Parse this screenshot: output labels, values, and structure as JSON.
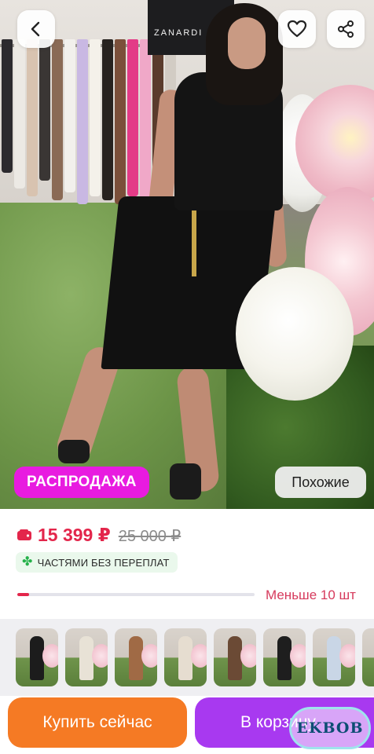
{
  "header": {
    "back_icon": "chevron-left-icon",
    "like_icon": "heart-icon",
    "share_icon": "share-icon"
  },
  "photo": {
    "store_sign": "ZANARDI",
    "sale_badge": "РАСПРОДАЖА",
    "similar_button": "Похожие"
  },
  "price": {
    "current": "15 399 ₽",
    "old": "25 000 ₽",
    "wallet_icon": "wallet-icon",
    "installment_icon": "clover-icon",
    "installment_label": "ЧАСТЯМИ БЕЗ ПЕРЕПЛАТ",
    "accent_color": "#e3264b"
  },
  "stock": {
    "label": "Меньше 10 шт",
    "level": 0.05
  },
  "thumbnails": {
    "count": 8
  },
  "actions": {
    "buy_now": "Купить сейчас",
    "add_to_cart": "В корзину",
    "buy_color": "#f57a24",
    "cart_color": "#a839f0"
  },
  "watermark": {
    "text": "EKBOB"
  }
}
